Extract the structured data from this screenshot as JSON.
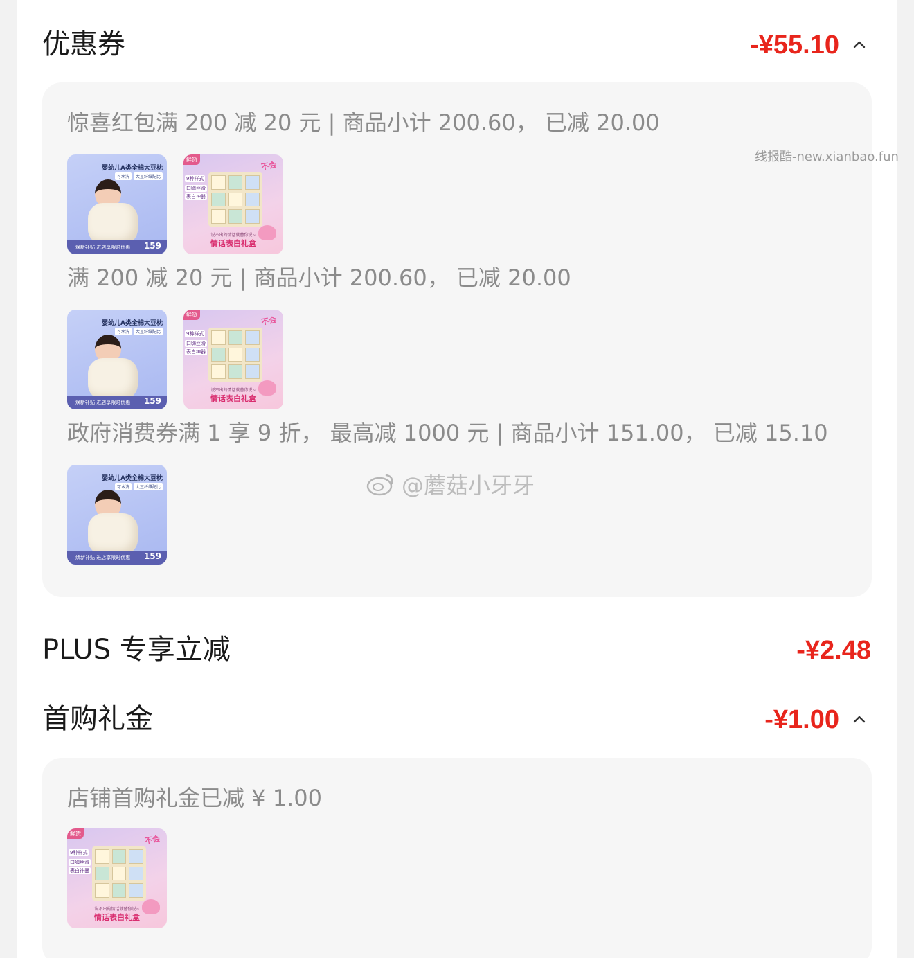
{
  "coupon_section": {
    "title": "优惠券",
    "amount": "-¥55.10",
    "expanded_icon": "chevron-up-icon",
    "entries": [
      {
        "text": "惊喜红包满 200 减 20 元 | 商品小计 200.60， 已减 20.00",
        "products": [
          "pillow",
          "gift"
        ]
      },
      {
        "text": "满 200 减 20 元 | 商品小计 200.60， 已减 20.00",
        "products": [
          "pillow",
          "gift"
        ]
      },
      {
        "text": "政府消费券满 1 享 9 折， 最高减 1000 元 | 商品小计 151.00， 已减 15.10",
        "products": [
          "pillow"
        ]
      }
    ]
  },
  "plus_section": {
    "title": "PLUS 专享立减",
    "amount": "-¥2.48"
  },
  "first_purchase_section": {
    "title": "首购礼金",
    "amount": "-¥1.00",
    "expanded_icon": "chevron-up-icon",
    "entries": [
      {
        "text": "店铺首购礼金已减 ¥ 1.00",
        "products": [
          "gift"
        ]
      }
    ]
  },
  "products": {
    "pillow": {
      "title": "婴幼儿A类全棉大豆枕",
      "tags": [
        "可水洗",
        "大豆纤维配比"
      ],
      "promo": "焕新补贴 进店享限时优惠",
      "price": "159"
    },
    "gift": {
      "brand": "鲜货",
      "badge": "不会",
      "tag1": "9种样式",
      "tag2": "口嗨丝滑",
      "tag3": "表白神器",
      "sub": "说不出的情话就替你说~",
      "footer": "情话表白礼盒"
    }
  },
  "watermarks": {
    "site": "线报酷-new.xianbao.fun",
    "weibo": "@蘑菇小牙牙"
  },
  "colors": {
    "accent": "#e8251c",
    "panel_bg": "#f6f6f6",
    "secondary_text": "#8b8b8b"
  }
}
